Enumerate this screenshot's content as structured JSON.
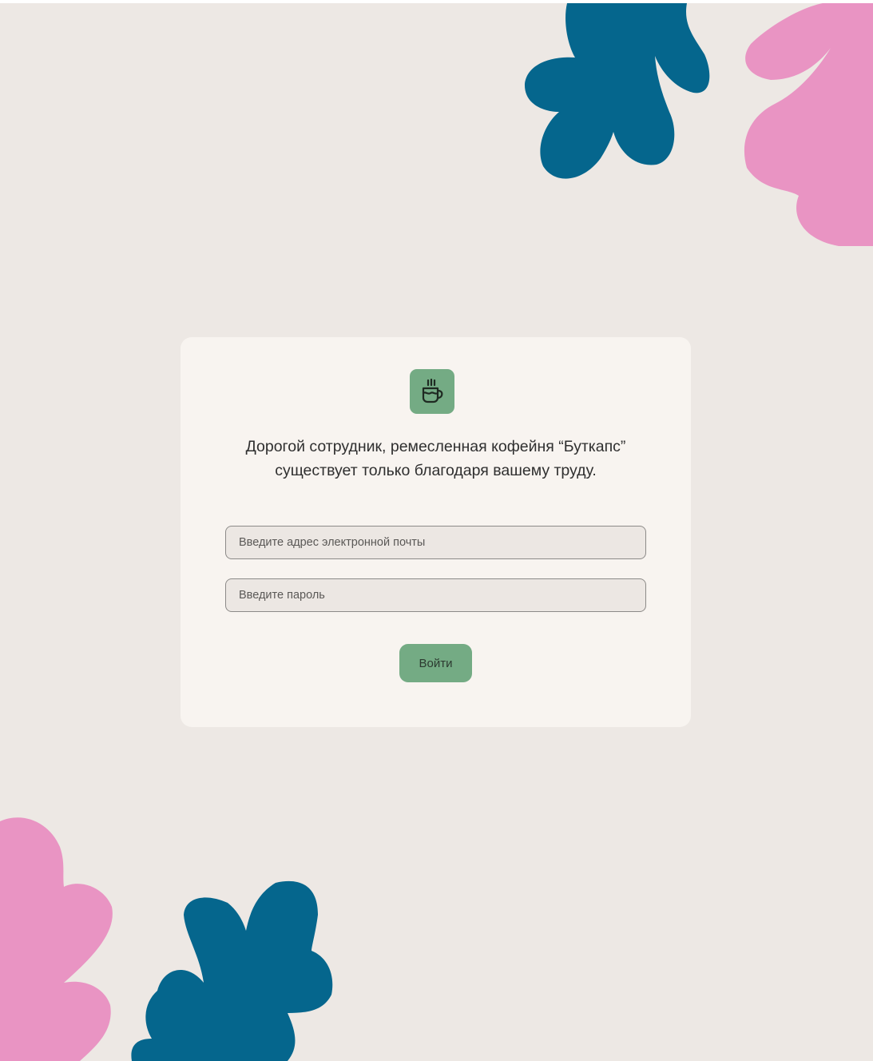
{
  "login": {
    "logo_icon": "coffee-cup-icon",
    "greeting_line1": "Дорогой сотрудник, ремесленная кофейня “Буткапс”",
    "greeting_line2": "существует только благодаря вашему труду.",
    "email_placeholder": "Введите адрес электронной почты",
    "password_placeholder": "Введите пароль",
    "submit_label": "Войти"
  },
  "colors": {
    "background": "#ede8e4",
    "card": "#f8f4f0",
    "accent_green": "#74ab84",
    "leaf_blue": "#05668d",
    "leaf_pink": "#e994c3"
  }
}
